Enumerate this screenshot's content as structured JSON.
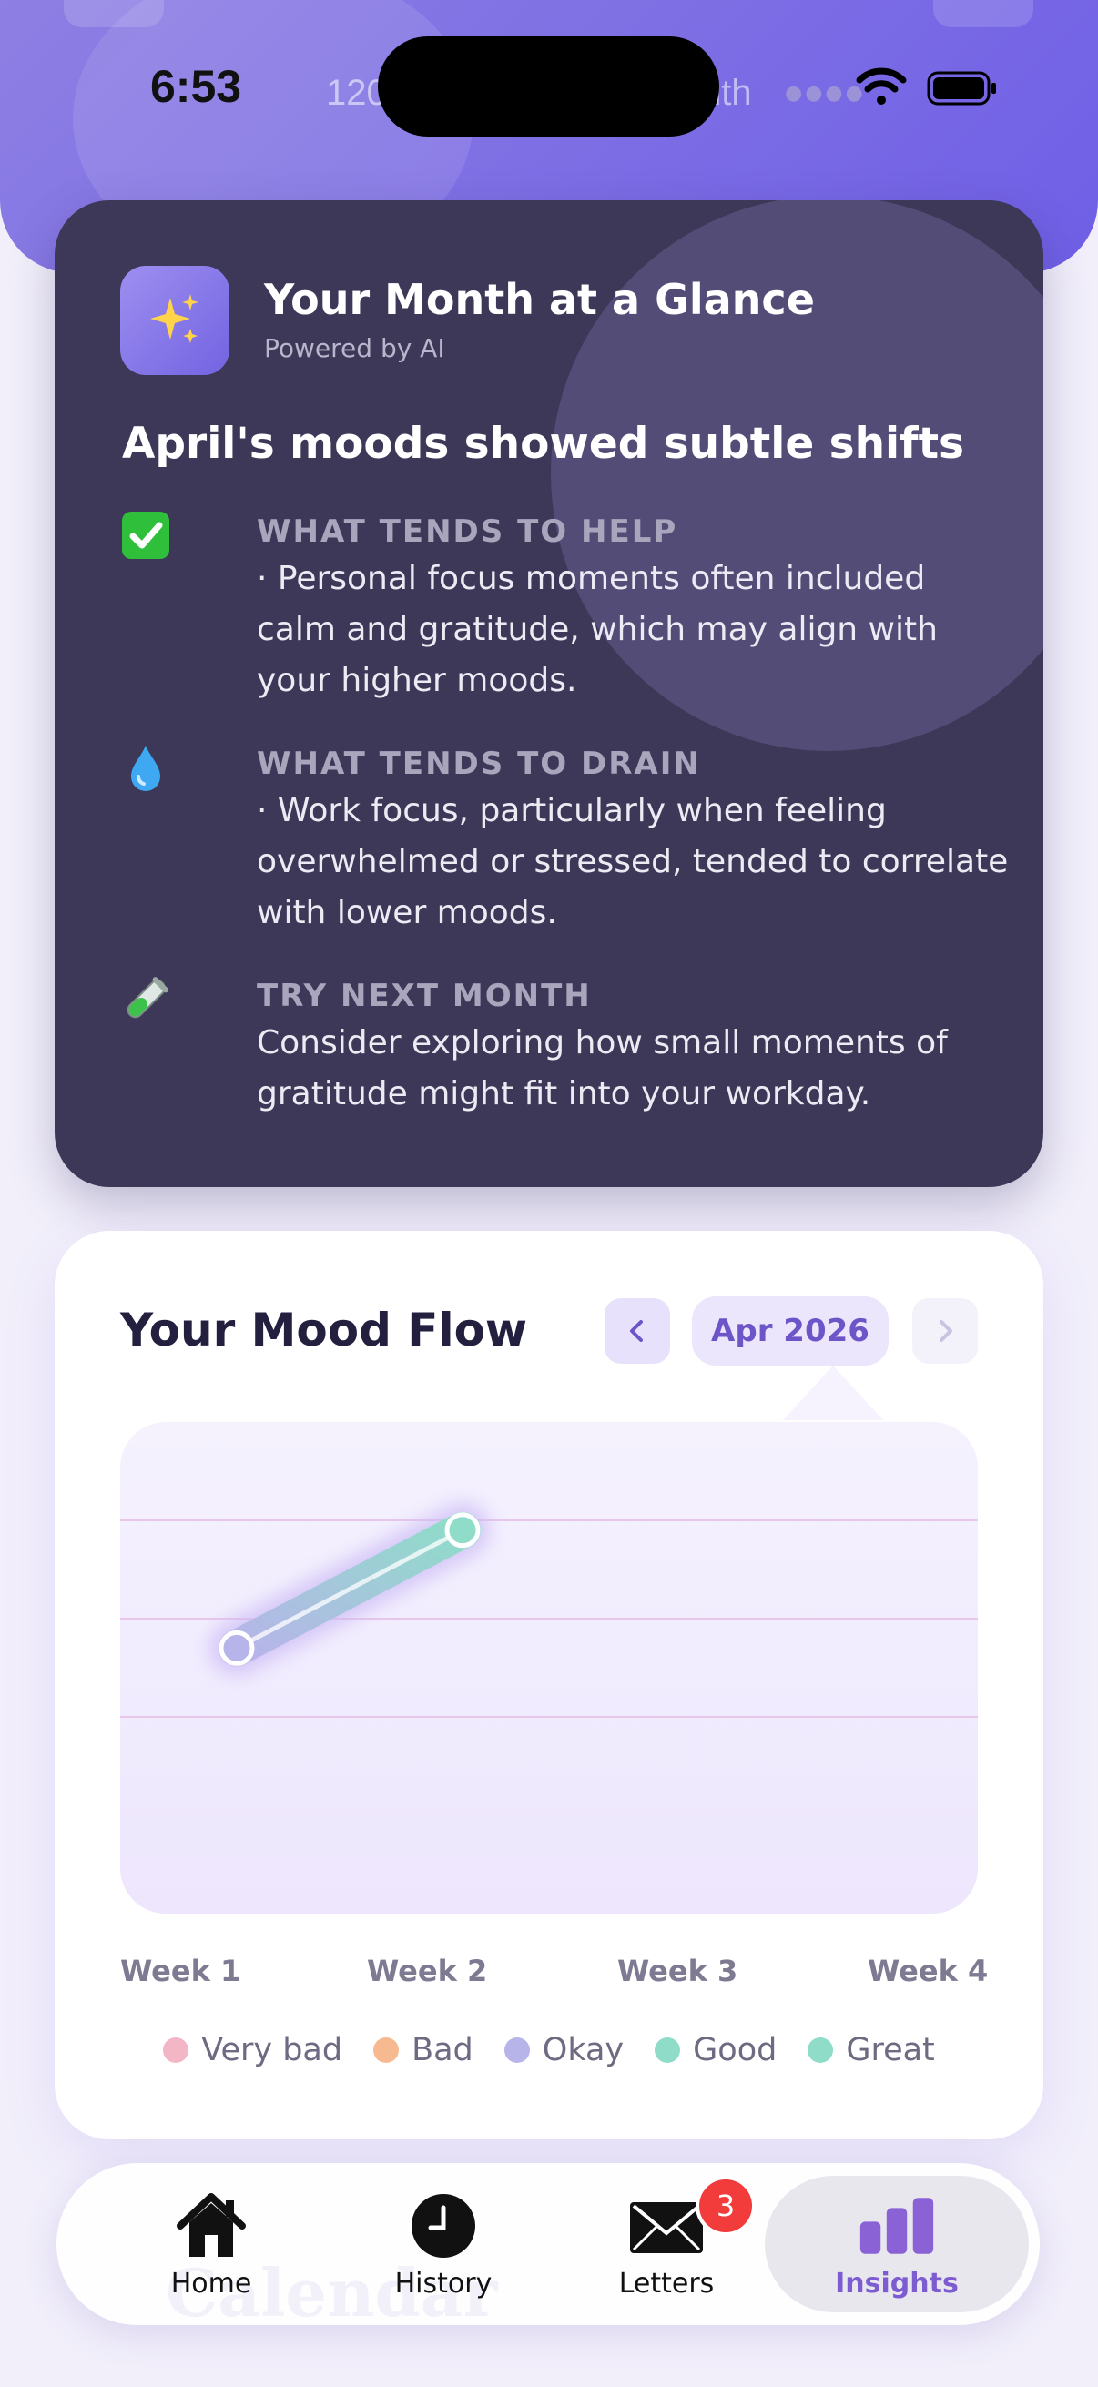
{
  "status_bar": {
    "time": "6:53",
    "peek_left": "120",
    "peek_right": "nth"
  },
  "ai_summary": {
    "title": "Your Month at a Glance",
    "subtitle": "Powered by AI",
    "headline": "April's moods showed subtle shifts",
    "sections": [
      {
        "icon": "check-icon",
        "label": "WHAT TENDS TO HELP",
        "body": "· Personal focus moments often included calm and gratitude, which may align with your higher moods."
      },
      {
        "icon": "droplet-icon",
        "label": "WHAT TENDS TO DRAIN",
        "body": "· Work focus, particularly when feeling overwhelmed or stressed, tended to correlate with lower moods."
      },
      {
        "icon": "test-tube-icon",
        "label": "TRY NEXT MONTH",
        "body": "Consider exploring how small moments of gratitude might fit into your workday."
      }
    ]
  },
  "mood_flow": {
    "title": "Your Mood Flow",
    "month": "Apr 2026",
    "legend": [
      {
        "label": "Very bad",
        "color": "#f2b6c6"
      },
      {
        "label": "Bad",
        "color": "#f7b98f"
      },
      {
        "label": "Okay",
        "color": "#b7b4ea"
      },
      {
        "label": "Good",
        "color": "#8fdcc9"
      },
      {
        "label": "Great",
        "color": "#8fdcc9"
      }
    ]
  },
  "chart_data": {
    "type": "line",
    "categories": [
      "Week 1",
      "Week 2",
      "Week 3",
      "Week 4"
    ],
    "levels": [
      "Very bad",
      "Bad",
      "Okay",
      "Good",
      "Great"
    ],
    "series": [
      {
        "values": [
          2.7,
          3.9,
          null,
          null
        ]
      }
    ],
    "ylim": [
      0,
      5
    ],
    "gridlines": [
      2,
      3,
      4
    ]
  },
  "tabs": [
    {
      "label": "Home",
      "icon": "house-icon"
    },
    {
      "label": "History",
      "icon": "clock-icon"
    },
    {
      "label": "Letters",
      "icon": "envelope-icon",
      "badge": "3"
    },
    {
      "label": "Insights",
      "icon": "bar-chart-icon",
      "active": true
    }
  ],
  "ghost_text": "Calendar",
  "colors": {
    "accent": "#7d5bd0",
    "ai_card": "#3d3857",
    "badge": "#f23b3b"
  }
}
